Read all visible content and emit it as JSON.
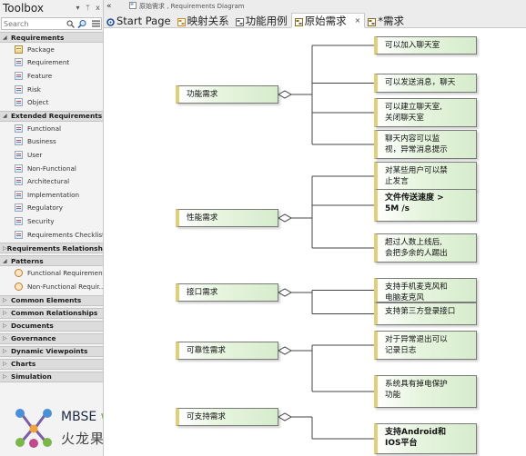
{
  "toolbox": {
    "title": "Toolbox",
    "pin_icon": "pin-icon",
    "close_symbol": "x",
    "search_placeholder": "Search",
    "sections": [
      {
        "label": "Requirements",
        "expanded": true,
        "items": [
          "Package",
          "Requirement",
          "Feature",
          "Risk",
          "Object"
        ]
      },
      {
        "label": "Extended Requirements",
        "expanded": true,
        "items": [
          "Functional",
          "Business",
          "User",
          "Non-Functional",
          "Architectural",
          "Implementation",
          "Regulatory",
          "Security",
          "Requirements Checklist"
        ]
      },
      {
        "label": "Requirements Relationships",
        "expanded": false,
        "items": []
      },
      {
        "label": "Patterns",
        "expanded": true,
        "items": [
          "Functional Requirements",
          "Non-Functional Requir..."
        ]
      },
      {
        "label": "Common Elements",
        "expanded": false,
        "items": []
      },
      {
        "label": "Common Relationships",
        "expanded": false,
        "items": []
      },
      {
        "label": "Documents",
        "expanded": false,
        "items": []
      },
      {
        "label": "Governance",
        "expanded": false,
        "items": []
      },
      {
        "label": "Dynamic Viewpoints",
        "expanded": false,
        "items": []
      },
      {
        "label": "Charts",
        "expanded": false,
        "items": []
      },
      {
        "label": "Simulation",
        "expanded": false,
        "items": []
      }
    ]
  },
  "watermark": {
    "text_en": "MBSE",
    "text_with": "with",
    "text_cn": "火龙果工程"
  },
  "tabs": {
    "collapse": "«",
    "breadcrumb": "原始需求 ,  Requirements Diagram",
    "items": [
      {
        "label": "Start Page",
        "icon": "start-page-icon",
        "active": false
      },
      {
        "label": "映射关系",
        "icon": "diagram-icon",
        "active": false
      },
      {
        "label": "功能用例",
        "icon": "usecase-icon",
        "active": false
      },
      {
        "label": "原始需求",
        "icon": "requirements-diagram-icon",
        "active": true
      },
      {
        "label": "*需求",
        "icon": "requirements-diagram-icon",
        "active": false
      }
    ],
    "close_symbol": "×"
  },
  "diagram": {
    "groups": [
      {
        "parent": "功能需求",
        "children": [
          "可以加入聊天室",
          "可以发送消息，聊天",
          "可以建立聊天室,\n关闭聊天室",
          "聊天内容可以监\n视，异常消息提示"
        ]
      },
      {
        "parent": "性能需求",
        "children": [
          "对某些用户可以禁\n止发言",
          "文件传送速度 >\n5M /s",
          "超过人数上线后,\n会把多余的人踢出"
        ]
      },
      {
        "parent": "接口需求",
        "children": [
          "支持手机麦克风和\n电脑麦克风",
          "支持第三方登录接口"
        ]
      },
      {
        "parent": "可靠性需求",
        "children": [
          "对于异常退出可以\n记录日志",
          "系统具有掉电保护\n功能"
        ]
      },
      {
        "parent": "可支持需求",
        "children": [
          "支持Android和\nIOS平台"
        ]
      }
    ]
  }
}
